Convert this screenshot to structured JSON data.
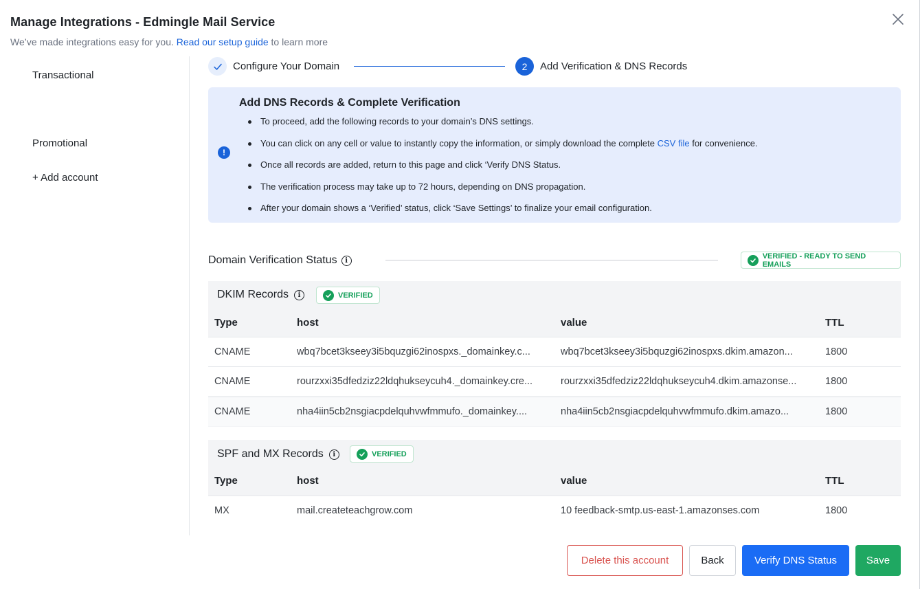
{
  "header": {
    "title": "Manage Integrations - Edmingle Mail Service",
    "subtitle_prefix": "We’ve made integrations easy for you.",
    "subtitle_link": "Read our setup guide",
    "subtitle_suffix": "to learn more",
    "close_icon": "close-icon"
  },
  "sidebar": {
    "items": [
      {
        "label": "Transactional"
      },
      {
        "label": "Promotional"
      },
      {
        "label": "+ Add account"
      }
    ]
  },
  "stepper": {
    "step1": {
      "label": "Configure Your Domain",
      "icon": "check-icon"
    },
    "step2": {
      "number": "2",
      "label": "Add Verification & DNS Records"
    },
    "accent": "#1a63d9"
  },
  "info": {
    "icon_glyph": "!",
    "title": "Add DNS Records & Complete Verification",
    "bullets": {
      "b1": "To proceed, add the following records to your domain’s DNS settings.",
      "b2_prefix": "You can click on any cell or value to instantly copy the information, or simply download the complete",
      "b2_link": "CSV file",
      "b2_suffix": "for convenience.",
      "b3": "Once all records are added, return to this page and click ‘Verify DNS Status.",
      "b4": "The verification process may take up to 72 hours, depending on DNS propagation.",
      "b5": "After your domain shows a ‘Verified’ status, click ‘Save Settings’ to finalize your email configuration."
    }
  },
  "verification": {
    "title": "Domain Verification Status",
    "info_glyph": "i",
    "status_badge": "VERIFIED - READY TO SEND EMAILS",
    "status_color": "#15a05a"
  },
  "dkim": {
    "title": "DKIM Records",
    "info_glyph": "i",
    "badge": "VERIFIED",
    "columns": {
      "type": "Type",
      "host": "host",
      "value": "value",
      "ttl": "TTL"
    },
    "rows": [
      {
        "type": "CNAME",
        "host": "wbq7bcet3kseey3i5bquzgi62inospxs._domainkey.c...",
        "value": "wbq7bcet3kseey3i5bquzgi62inospxs.dkim.amazon...",
        "ttl": "1800"
      },
      {
        "type": "CNAME",
        "host": "rourzxxi35dfedziz22ldqhukseycuh4._domainkey.cre...",
        "value": "rourzxxi35dfedziz22ldqhukseycuh4.dkim.amazonse...",
        "ttl": "1800"
      },
      {
        "type": "CNAME",
        "host": "nha4iin5cb2nsgiacpdelquhvwfmmufo._domainkey....",
        "value": "nha4iin5cb2nsgiacpdelquhvwfmmufo.dkim.amazo...",
        "ttl": "1800"
      }
    ]
  },
  "spf": {
    "title": "SPF and MX Records",
    "info_glyph": "i",
    "badge": "VERIFIED",
    "columns": {
      "type": "Type",
      "host": "host",
      "value": "value",
      "ttl": "TTL"
    },
    "rows": [
      {
        "type": "MX",
        "host": "mail.createteachgrow.com",
        "value": "10 feedback-smtp.us-east-1.amazonses.com",
        "ttl": "1800"
      }
    ]
  },
  "footer": {
    "delete_label": "Delete this account",
    "back_label": "Back",
    "verify_label": "Verify DNS Status",
    "save_label": "Save",
    "danger_color": "#d9534f",
    "primary_color": "#1a6cf5",
    "success_color": "#1fa862"
  }
}
